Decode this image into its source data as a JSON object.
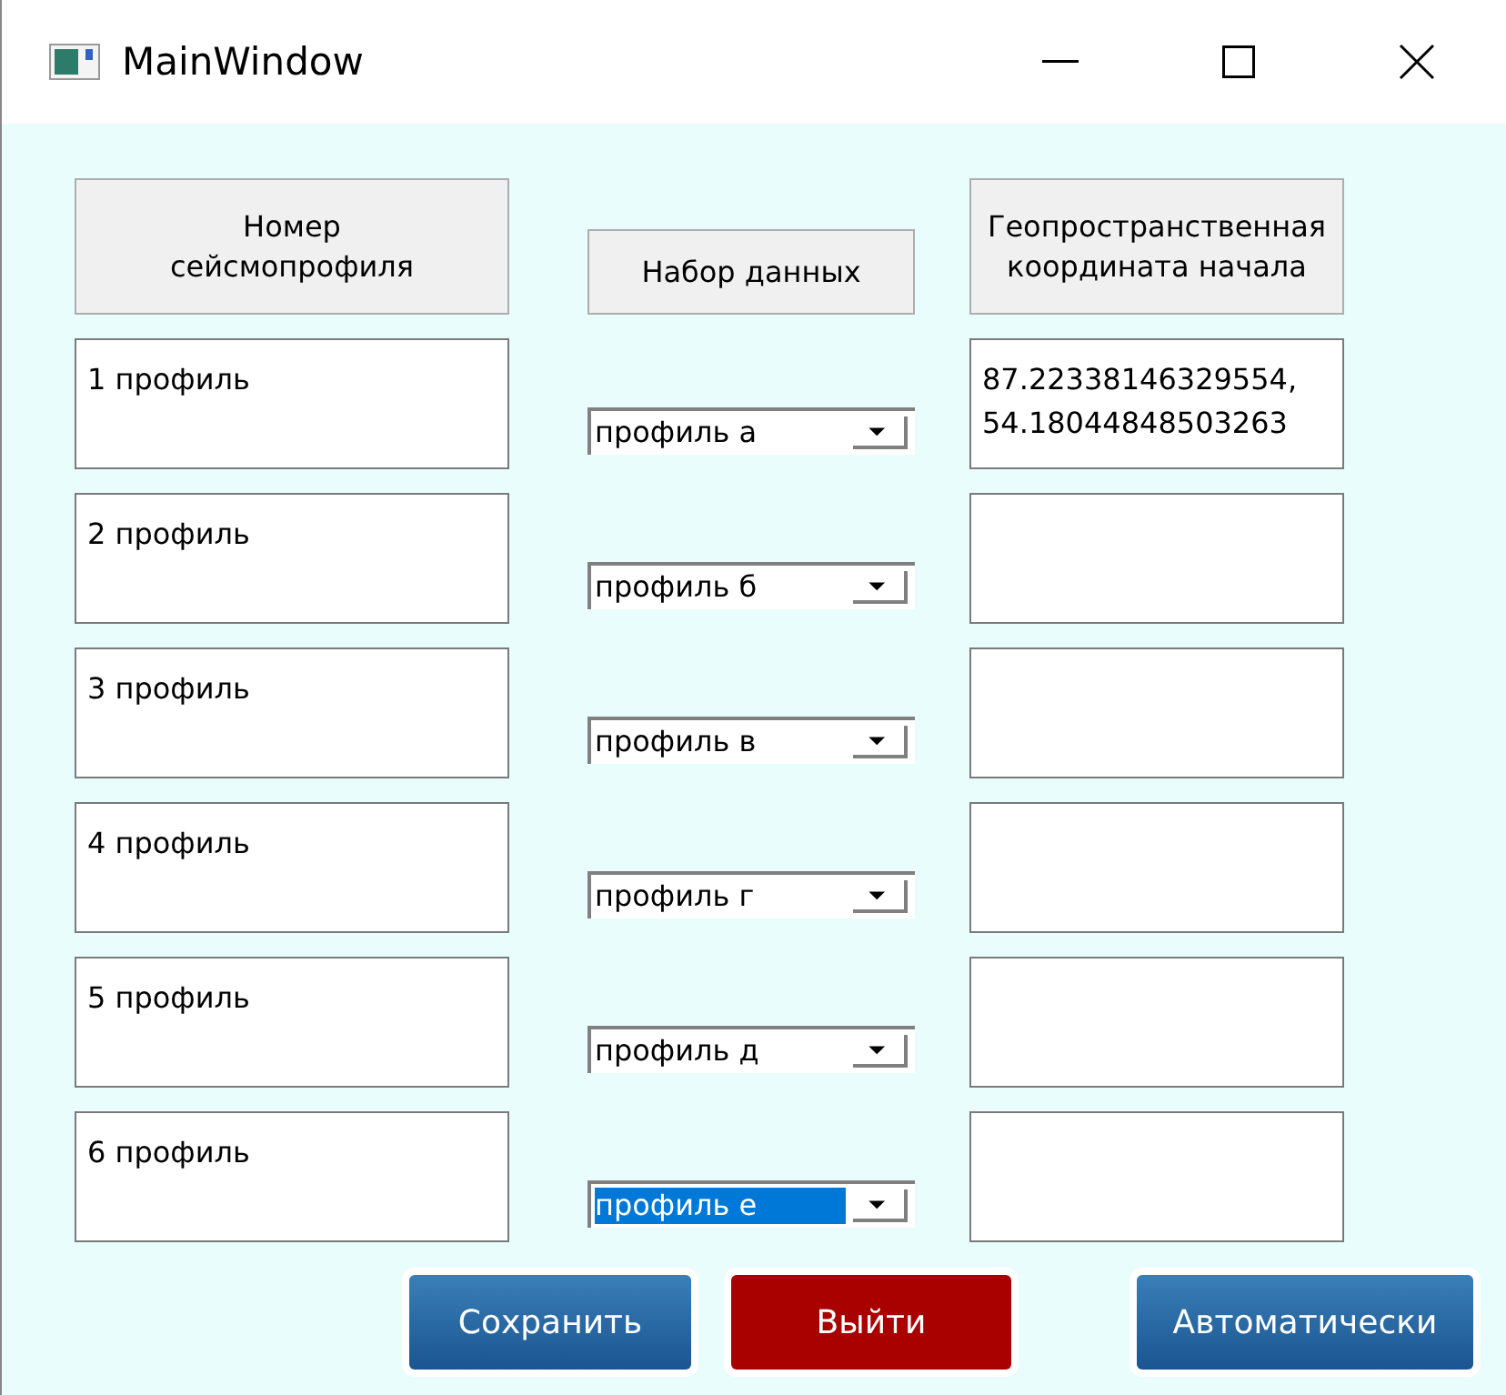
{
  "window": {
    "title": "MainWindow"
  },
  "headers": [
    "Номер сейсмопрофиля",
    "Набор данных",
    "Геопространственная координата начала"
  ],
  "rows": [
    {
      "name": "1 профиль",
      "dataset": "профиль а",
      "dataset_focused": false,
      "coordinate": "87.22338146329554, 54.18044848503263"
    },
    {
      "name": "2 профиль",
      "dataset": "профиль б",
      "dataset_focused": false
    },
    {
      "name": "3 профиль",
      "dataset": "профиль в",
      "dataset_focused": false
    },
    {
      "name": "4 профиль",
      "dataset": "профиль г",
      "dataset_focused": false
    },
    {
      "name": "5 профиль",
      "dataset": "профиль д",
      "dataset_focused": false
    },
    {
      "name": "6 профиль",
      "dataset": "профиль е",
      "dataset_focused": true
    }
  ],
  "buttons": [
    {
      "label": "Сохранить",
      "kind": "primary"
    },
    {
      "label": "Выйти",
      "kind": "danger"
    },
    {
      "label": "Автоматически",
      "kind": "primary"
    }
  ]
}
